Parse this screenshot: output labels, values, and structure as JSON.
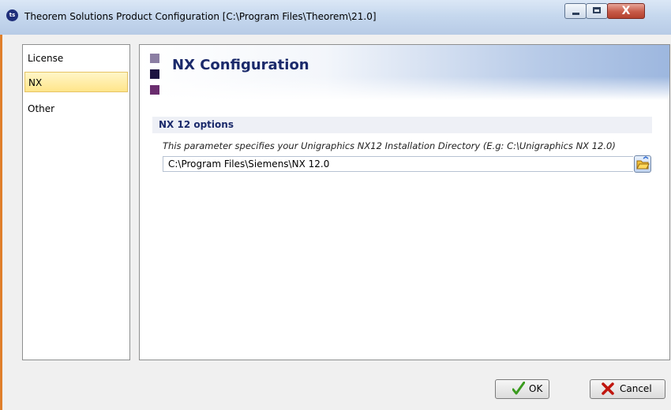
{
  "window": {
    "title": "Theorem Solutions Product Configuration [C:\\Program Files\\Theorem\\21.0]",
    "app_icon_text": "ts",
    "close_glyph": "X"
  },
  "sidebar": {
    "items": [
      {
        "label": "License",
        "selected": false
      },
      {
        "label": "NX",
        "selected": true
      },
      {
        "label": "Other",
        "selected": false
      }
    ]
  },
  "main": {
    "title": "NX Configuration",
    "section_title": "NX 12 options",
    "parameter_description": "This parameter specifies your Unigraphics NX12 Installation Directory (E.g: C:\\Unigraphics NX 12.0)",
    "path_value": "C:\\Program Files\\Siemens\\NX 12.0"
  },
  "buttons": {
    "ok_label": "OK",
    "cancel_label": "Cancel"
  },
  "colors": {
    "title_color": "#1b2a6b",
    "selected_item": "#ffe58a",
    "ok_icon": "#3a9b1e",
    "cancel_icon": "#c0160f"
  }
}
